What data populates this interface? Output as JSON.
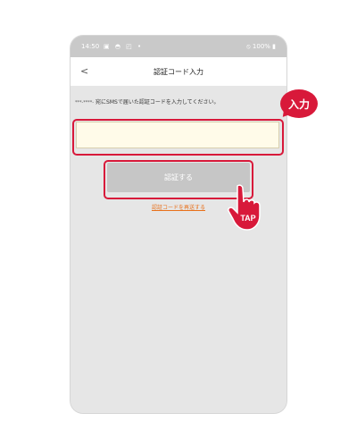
{
  "status_bar": {
    "time": "14:50",
    "left_icons": "▣ ◓ ◰ •",
    "right_status": "100%"
  },
  "header": {
    "back_symbol": "<",
    "title": "認証コード入力"
  },
  "main": {
    "masked_number": "***-****-",
    "instruction": "宛にSMSで届いた認証コードを入力してください。",
    "code_input": {
      "value": "",
      "placeholder": ""
    },
    "verify_button_label": "認証する",
    "resend_link_label": "認証コードを再送する"
  },
  "annotations": {
    "input_badge_label": "入力",
    "tap_label": "TAP"
  },
  "colors": {
    "accent_red": "#d8193a",
    "link_orange": "#e8711b",
    "button_disabled": "#c6c6c6",
    "input_background": "#fffbe9"
  }
}
